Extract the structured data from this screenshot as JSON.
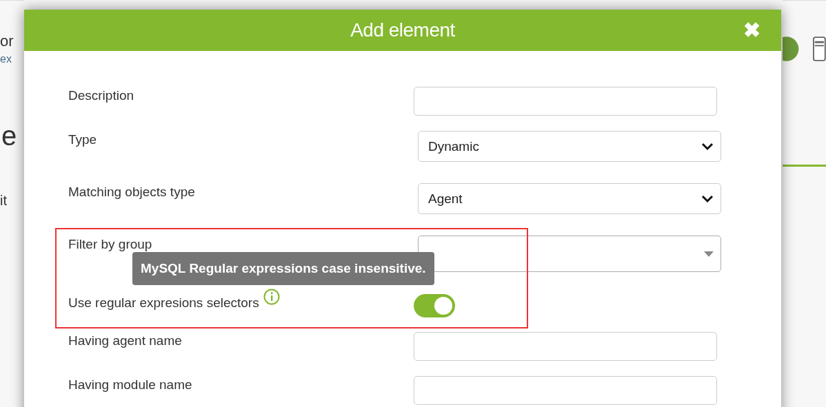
{
  "background": {
    "fragments": [
      {
        "kind": "heading",
        "text": "or"
      },
      {
        "kind": "link",
        "text": "ex"
      },
      {
        "kind": "title",
        "text": "e"
      },
      {
        "kind": "body",
        "text": "it"
      }
    ]
  },
  "dialog": {
    "title": "Add element",
    "close": "✖",
    "rows": [
      {
        "kind": "text",
        "label": "Description",
        "value": ""
      },
      {
        "kind": "select",
        "label": "Type",
        "value": "Dynamic"
      },
      {
        "kind": "select",
        "label": "Matching objects type",
        "value": "Agent"
      },
      {
        "kind": "group",
        "label": "Filter by group"
      },
      {
        "kind": "toggle",
        "label": "Use regular expresions selectors",
        "on": true,
        "info": true
      },
      {
        "kind": "text",
        "label": "Having agent name",
        "value": ""
      },
      {
        "kind": "text",
        "label": "Having module name",
        "value": ""
      }
    ],
    "tooltip": "MySQL Regular expressions case insensitive."
  }
}
